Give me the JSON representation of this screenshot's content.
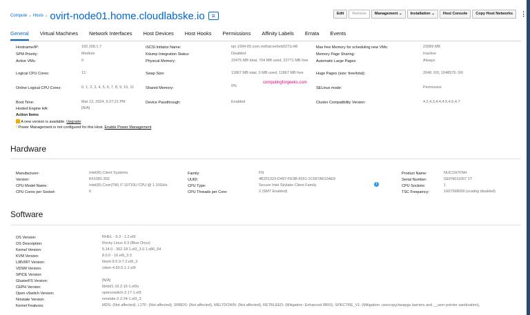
{
  "breadcrumb": {
    "compute": "Compute",
    "hosts": "Hosts",
    "host_name": "ovirt-node01.home.cloudlabske.io"
  },
  "toolbar": {
    "edit": "Edit",
    "remove": "Remove",
    "management": "Management ⌄",
    "installation": "Installation ⌄",
    "host_console": "Host Console",
    "copy_networks": "Copy Host Networks",
    "more": "⋮"
  },
  "tabs": [
    "General",
    "Virtual Machines",
    "Network Interfaces",
    "Host Devices",
    "Host Hooks",
    "Permissions",
    "Affinity Labels",
    "Errata",
    "Events"
  ],
  "general": {
    "col1": [
      {
        "label": "Hostname/IP:",
        "value": "192.168.1.7"
      },
      {
        "label": "SPM Priority:",
        "value": "Medium"
      },
      {
        "label": "Active VMs:",
        "value": "0"
      },
      {
        "label": "Logical CPU Cores:",
        "value": "12"
      },
      {
        "label": "Online Logical CPU Cores:",
        "value": "0, 1, 2, 3, 4, 5, 6, 7, 8, 9, 10, 11"
      },
      {
        "label": "Boot Time:",
        "value": "Mar 13, 2024, 6:27:21 PM"
      },
      {
        "label": "Hosted Engine HA:",
        "value": "[N/A]"
      }
    ],
    "col2": [
      {
        "label": "iSCSI Initiator Name:",
        "value": "iqn.1994-05.com.redhat:ee6eb0271c48"
      },
      {
        "label": "Kdump Integration Status:",
        "value": "Disabled"
      },
      {
        "label": "Physical Memory:",
        "value": "23475 MB total, 704 MB used, 22771 MB free"
      },
      {
        "label": "Swap Size:",
        "value": "11867 MB total, 0 MB used, 11867 MB free"
      },
      {
        "label": "Shared Memory:",
        "value": "0%"
      },
      {
        "label": "Device Passthrough:",
        "value": "Enabled"
      }
    ],
    "col3": [
      {
        "label": "Max free Memory for scheduling new VMs:",
        "value": "23089 MB"
      },
      {
        "label": "Memory Page Sharing:",
        "value": "Inactive"
      },
      {
        "label": "Automatic Large Pages:",
        "value": "Always"
      },
      {
        "label": "Huge Pages (size: free/total):",
        "value": "2048: 0/0, 1048576: 0/0"
      },
      {
        "label": "SELinux mode:",
        "value": "Permissive"
      },
      {
        "label": "Cluster Compatibility Version:",
        "value": "4.2,4.3,4.4,4.5,4.6,4.7"
      }
    ],
    "action_items_title": "Action Items",
    "action_new_version": "A new version is available.",
    "action_upgrade_link": "Upgrade",
    "action_power": "Power Management is not configured for this Host.",
    "action_power_link": "Enable Power Management",
    "watermark": "computingforgeeks.com"
  },
  "hardware": {
    "title": "Hardware",
    "col1": [
      {
        "label": "Manufacturer:",
        "value": "Intel(R) Client Systems"
      },
      {
        "label": "Version:",
        "value": "K61081-302"
      },
      {
        "label": "CPU Model Name:",
        "value": "Intel(R) Core(TM) i7-10710U CPU @ 1.10GHz"
      },
      {
        "label": "CPU Cores per Socket:",
        "value": "6"
      }
    ],
    "col2": [
      {
        "label": "Family:",
        "value": "FN"
      },
      {
        "label": "UUID:",
        "value": "4B251323-D497-FE3B-6551-1C697A610AE9"
      },
      {
        "label": "CPU Type:",
        "value": "Secure Intel Skylake Client Family"
      },
      {
        "label": "CPU Threads per Core:",
        "value": "2 (SMT Enabled)"
      }
    ],
    "col3": [
      {
        "label": "Product Name:",
        "value": "NUC10i7FNH"
      },
      {
        "label": "Serial Number:",
        "value": "GEFN011007 1T"
      },
      {
        "label": "CPU Sockets:",
        "value": "1"
      },
      {
        "label": "TSC Frequency:",
        "value": "1607998000 (scaling disabled)"
      }
    ]
  },
  "software": {
    "title": "Software",
    "rows": [
      {
        "label": "OS Version:",
        "value": "RHEL - 9.3 - 1.2.el9"
      },
      {
        "label": "OS Description:",
        "value": "Rocky Linux 9.3 (Blue Onyx)"
      },
      {
        "label": "Kernel Version:",
        "value": "5.14.0 - 362.18.1.el9_3.0.1.x86_64"
      },
      {
        "label": "KVM Version:",
        "value": "8.0.0 - 16.el9_3.3"
      },
      {
        "label": "LIBVIRT Version:",
        "value": "libvirt-9.5.0-7.2.el9_3"
      },
      {
        "label": "VDSM Version:",
        "value": "vdsm-4.50.5.1-1.el9"
      },
      {
        "label": "SPICE Version:",
        "value": ""
      },
      {
        "label": "GlusterFS Version:",
        "value": "[N/A]"
      },
      {
        "label": "CEPH Version:",
        "value": "librbd1-16.2.15-1.el9s"
      },
      {
        "label": "Open vSwitch Version:",
        "value": "openvswitch-2.17-1.el9"
      },
      {
        "label": "Nmstate Version:",
        "value": "nmstate-2.2.24-1.el9_3"
      },
      {
        "label": "Kernel Features:",
        "value": "MDS: (Not affected), L1TF: (Not affected), SRBDS: (Not affected), MELTDOWN: (Not affected), RETBLEED: (Mitigation: Enhanced IBRS), SPECTRE_V1: (Mitigation: usercopy/swapgs barriers and __user pointer sanitization),"
      }
    ]
  },
  "colors": {
    "link": "#0066cc",
    "accent": "#0066cc",
    "muted": "#6a6e73",
    "watermark": "#e0007a",
    "info": "#2b9af3"
  }
}
